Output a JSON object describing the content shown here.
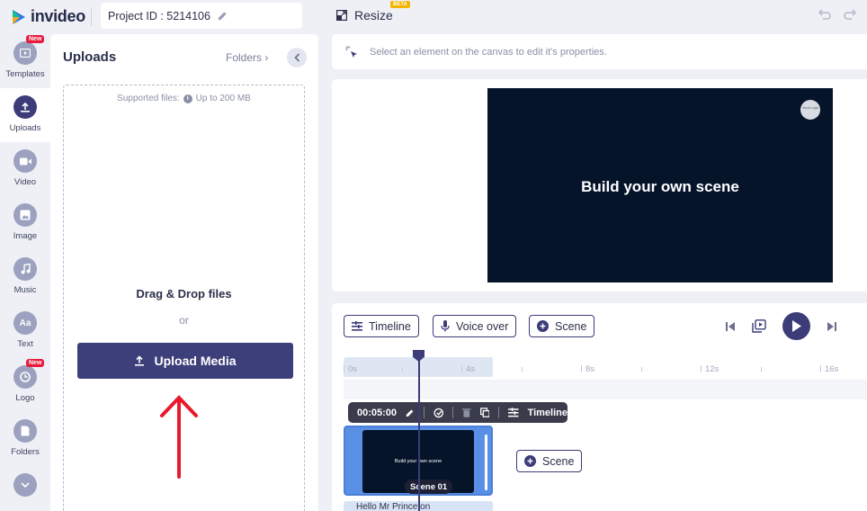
{
  "app": {
    "name": "invideo"
  },
  "project": {
    "label": "Project ID : 5214106"
  },
  "resize": {
    "label": "Resize",
    "badge": "BETA"
  },
  "nav": [
    {
      "label": "Templates",
      "icon": "templates-icon",
      "badge": "New"
    },
    {
      "label": "Uploads",
      "icon": "upload-icon",
      "active": true
    },
    {
      "label": "Video",
      "icon": "video-icon"
    },
    {
      "label": "Image",
      "icon": "image-icon"
    },
    {
      "label": "Music",
      "icon": "music-icon"
    },
    {
      "label": "Text",
      "icon": "text-icon",
      "glyph": "Aa"
    },
    {
      "label": "Logo",
      "icon": "logo-icon",
      "badge": "New"
    },
    {
      "label": "Folders",
      "icon": "folder-icon"
    }
  ],
  "uploads": {
    "title": "Uploads",
    "folders_link": "Folders",
    "supported_label": "Supported files:",
    "supported_size": "Up to 200 MB",
    "drag_drop": "Drag & Drop files",
    "or": "or",
    "upload_button": "Upload Media"
  },
  "properties": {
    "hint": "Select an element on the canvas to edit it's properties."
  },
  "canvas": {
    "scene_title": "Build your own scene",
    "logo_badge": "Your Logo"
  },
  "timeline": {
    "buttons": {
      "timeline": "Timeline",
      "voice_over": "Voice over",
      "scene": "Scene"
    },
    "ticks": [
      "0s",
      "4s",
      "8s",
      "12s",
      "16s"
    ],
    "scene_toolbar": {
      "duration": "00:05:00",
      "timeline": "Timeline"
    },
    "clip": {
      "text": "Build your own scene",
      "label": "Scene 01"
    },
    "add_scene": "Scene",
    "audio": "Hello Mr Princeton"
  },
  "colors": {
    "accent": "#3b3c78",
    "new_badge": "#e8193c",
    "beta_badge": "#f5b400",
    "scene_bg": "#06142a",
    "clip_blue": "#5a8fe6"
  }
}
